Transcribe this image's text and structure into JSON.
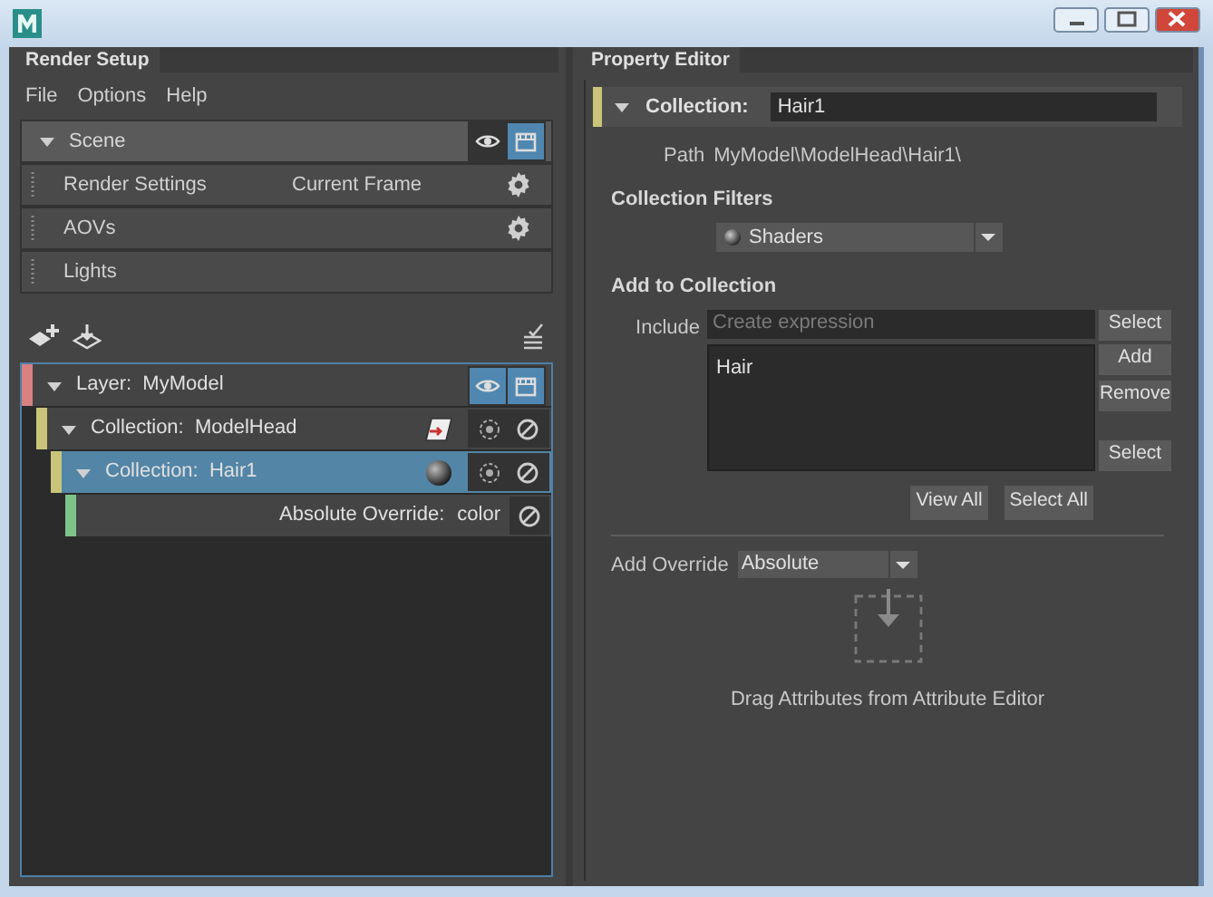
{
  "render_setup": {
    "tab": "Render Setup",
    "menu": [
      "File",
      "Options",
      "Help"
    ],
    "scene": {
      "label": "Scene",
      "expanded": true,
      "visible": false,
      "renderable": true
    },
    "scene_items": [
      {
        "label": "Render Settings",
        "value": "Current Frame",
        "kind": "settings"
      },
      {
        "label": "AOVs",
        "kind": "settings"
      },
      {
        "label": "Lights",
        "kind": "plain"
      }
    ],
    "tree": [
      {
        "kind": "layer",
        "prefix": "Layer:",
        "name": "MyModel",
        "color": "#d98080",
        "expanded": true,
        "selected": false,
        "visible": true,
        "renderable": true,
        "children": [
          {
            "kind": "collection",
            "prefix": "Collection:",
            "name": "ModelHead",
            "color": "#c9c47a",
            "expanded": true,
            "selected": false,
            "filter_icon": {
              "kind": "transforms"
            },
            "children": [
              {
                "kind": "collection",
                "prefix": "Collection:",
                "name": "Hair1",
                "color": "#c9c47a",
                "expanded": true,
                "selected": true,
                "filter_icon": {
                  "kind": "shaders"
                },
                "children": [
                  {
                    "kind": "override",
                    "label": "Absolute Override:",
                    "attribute": "color",
                    "color": "#7cc48a",
                    "selected": false
                  }
                ]
              }
            ]
          }
        ]
      }
    ]
  },
  "property_editor": {
    "tab": "Property Editor",
    "collection": {
      "label": "Collection:",
      "name": "Hair1",
      "expanded": true,
      "color": "#c9c47a"
    },
    "path_label": "Path",
    "path": "MyModel\\ModelHead\\Hair1\\",
    "filters_heading": "Collection Filters",
    "filter": "Shaders",
    "add_heading": "Add to Collection",
    "include_label": "Include",
    "include_placeholder": "Create expression",
    "include_button": "Select",
    "items": [
      "Hair"
    ],
    "list_buttons": [
      "Add",
      "Remove"
    ],
    "list_bottom_button": "Select",
    "view_buttons": [
      "View All",
      "Select All"
    ],
    "add_override_label": "Add Override",
    "override_mode": "Absolute",
    "drop_hint": "Drag Attributes from Attribute Editor"
  }
}
